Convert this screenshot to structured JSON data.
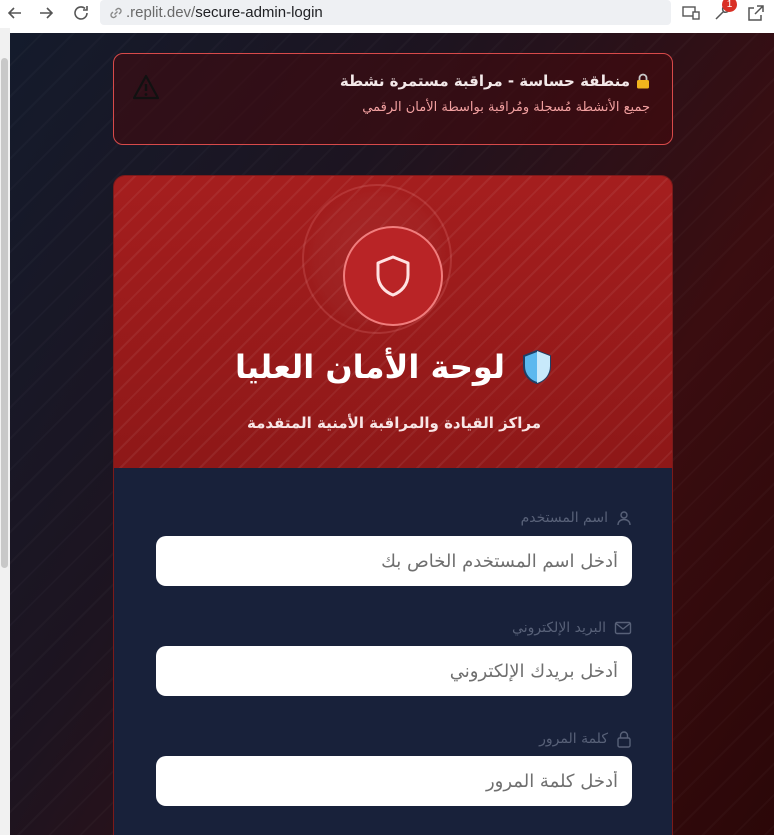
{
  "browser": {
    "url_domain": ".replit.dev/",
    "url_path": "secure-admin-login",
    "notification_count": "1"
  },
  "warning": {
    "title": "منطقة حساسة - مراقبة مستمرة نشطة",
    "subtitle": "جميع الأنشطة مُسجلة ومُراقبة بواسطة الأمان الرقمي",
    "icon": "warning-triangle-icon"
  },
  "card": {
    "title": "لوحة الأمان العليا",
    "subtitle": "مراكز القيادة والمراقبة الأمنية المتقدمة"
  },
  "form": {
    "username_label": "اسم المستخدم",
    "username_placeholder": "أدخل اسم المستخدم الخاص بك",
    "email_label": "البريد الإلكتروني",
    "email_placeholder": "أدخل بريدك الإلكتروني",
    "password_label": "كلمة المرور",
    "password_placeholder": "أدخل كلمة المرور"
  },
  "colors": {
    "header_red": "#a01c1c",
    "body_navy": "#18213a",
    "warning_border": "#d84a4a"
  }
}
